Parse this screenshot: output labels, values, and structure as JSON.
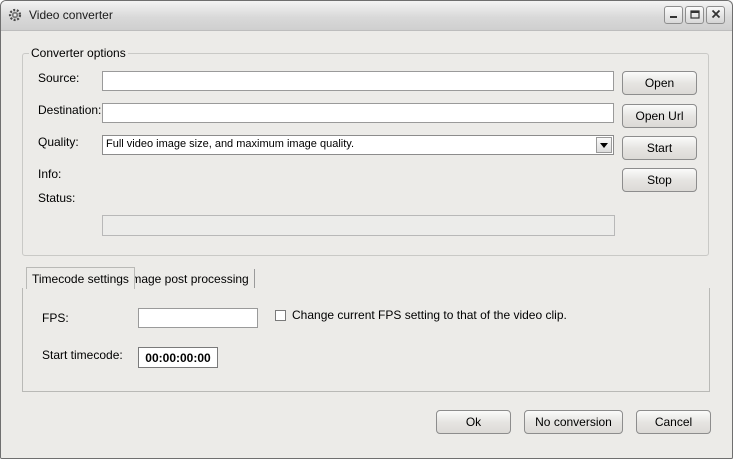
{
  "window": {
    "title": "Video converter"
  },
  "converter_options": {
    "group_title": "Converter options",
    "source_label": "Source:",
    "source_value": "",
    "destination_label": "Destination:",
    "destination_value": "",
    "quality_label": "Quality:",
    "quality_selected": "Full video image size, and maximum image quality.",
    "info_label": "Info:",
    "status_label": "Status:"
  },
  "side_buttons": {
    "open": "Open",
    "open_url": "Open Url",
    "start": "Start",
    "stop": "Stop"
  },
  "tabs": [
    {
      "label": "Timecode settings",
      "active": true
    },
    {
      "label": "Image post processing",
      "active": false
    }
  ],
  "timecode_settings": {
    "fps_label": "FPS:",
    "fps_value": "",
    "change_fps_checkbox_label": "Change current FPS setting to that of the video clip.",
    "change_fps_checked": false,
    "start_timecode_label": "Start timecode:",
    "start_timecode_value": "00:00:00:00"
  },
  "bottom_buttons": {
    "ok": "Ok",
    "no_conversion": "No conversion",
    "cancel": "Cancel"
  },
  "icons": {
    "app": "gear-icon",
    "minimize": "minimize-icon",
    "maximize": "maximize-icon",
    "close": "close-icon",
    "dropdown": "chevron-down-icon"
  }
}
